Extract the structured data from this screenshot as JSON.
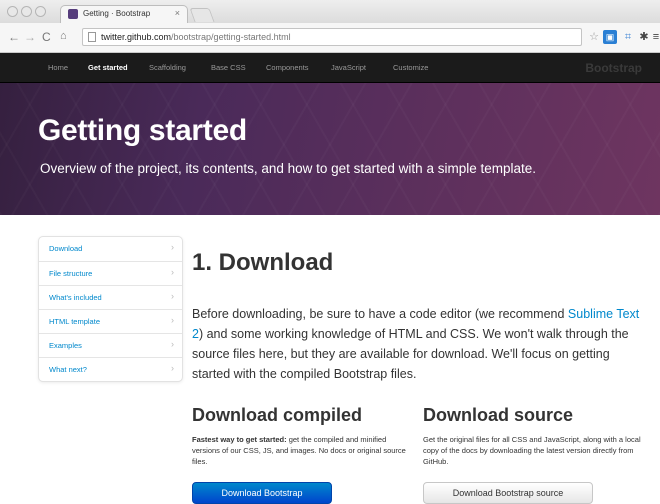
{
  "browser": {
    "tab_title": "Getting · Bootstrap",
    "tab_close": "×",
    "url_host": "twitter.github.com",
    "url_path": "/bootstrap/getting-started.html"
  },
  "navbar": {
    "items": [
      {
        "label": "Home"
      },
      {
        "label": "Get started"
      },
      {
        "label": "Scaffolding"
      },
      {
        "label": "Base CSS"
      },
      {
        "label": "Components"
      },
      {
        "label": "JavaScript"
      },
      {
        "label": "Customize"
      }
    ],
    "active_index": 1,
    "brand": "Bootstrap"
  },
  "jumbotron": {
    "title": "Getting started",
    "subtitle": "Overview of the project, its contents, and how to get started with a simple template."
  },
  "sidebar": {
    "items": [
      {
        "label": "Download"
      },
      {
        "label": "File structure"
      },
      {
        "label": "What's included"
      },
      {
        "label": "HTML template"
      },
      {
        "label": "Examples"
      },
      {
        "label": "What next?"
      }
    ]
  },
  "main": {
    "heading": "1. Download",
    "lead": {
      "before": "Before downloading, be sure to have a code editor (we recommend ",
      "link": "Sublime Text 2",
      "after": ") and some working knowledge of HTML and CSS. We won't walk through the source files here, but they are available for download. We'll focus on getting started with the compiled Bootstrap files."
    },
    "compiled": {
      "heading": "Download compiled",
      "text_strong": "Fastest way to get started:",
      "text": " get the compiled and minified versions of our CSS, JS, and images. No docs or original source files.",
      "button": "Download Bootstrap"
    },
    "source": {
      "heading": "Download source",
      "text": "Get the original files for all CSS and JavaScript, along with a local copy of the docs by downloading the latest version directly from GitHub.",
      "button": "Download Bootstrap source"
    }
  },
  "colors": {
    "link": "#0088cc",
    "navbar_bg": "#1b1b1b",
    "jumbotron_bg": "#4a2a59",
    "primary_button": "#0055cc"
  }
}
